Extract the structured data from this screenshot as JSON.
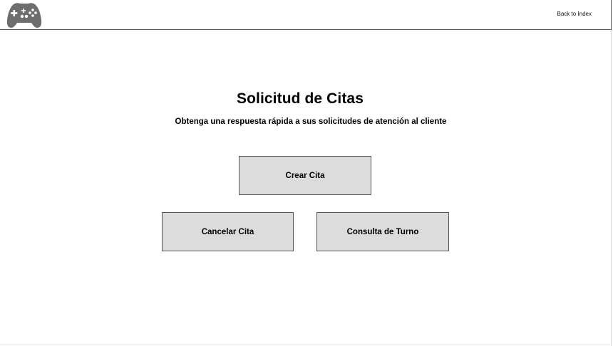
{
  "header": {
    "logo_icon": "gamepad-icon",
    "back_link": "Back to Index"
  },
  "main": {
    "title": "Solicitud de Citas",
    "subtitle": "Obtenga una respuesta rápida a sus solicitudes de atención al cliente",
    "buttons": {
      "crear": "Crear Cita",
      "cancelar": "Cancelar Cita",
      "consulta": "Consulta de Turno"
    }
  },
  "colors": {
    "button_fill": "#dcdcdc",
    "border": "#555555",
    "logo": "#6e6e6e"
  }
}
